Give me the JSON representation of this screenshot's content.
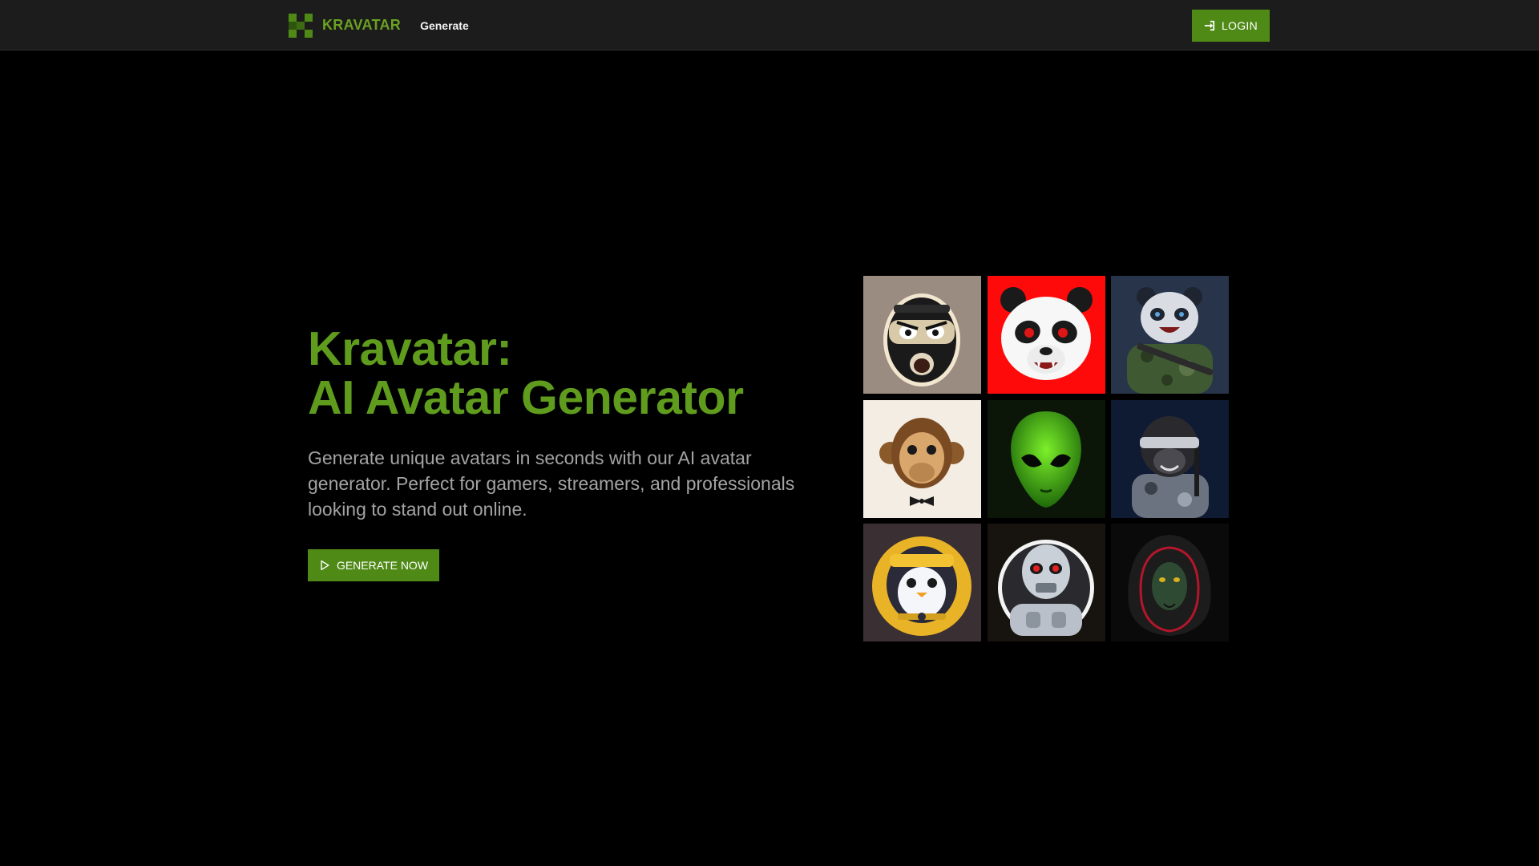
{
  "header": {
    "brand_name": "KRAVATAR",
    "nav_generate": "Generate",
    "login_label": "LOGIN",
    "icons": {
      "logo": "pixel-grid-logo-icon",
      "login": "sign-in-icon"
    }
  },
  "hero": {
    "title_line1": "Kravatar:",
    "title_line2": "AI Avatar Generator",
    "description": "Generate unique avatars in seconds with our AI avatar generator. Perfect for gamers, streamers, and professionals looking to stand out online.",
    "cta_label": "GENERATE NOW",
    "cta_icon": "play-icon"
  },
  "gallery": {
    "avatars": [
      {
        "subject": "masked-ninja",
        "bg": "#9b8c82"
      },
      {
        "subject": "angry-panda",
        "bg": "#ff0a0a"
      },
      {
        "subject": "soldier-panda",
        "bg": "#27344a"
      },
      {
        "subject": "monkey-bowtie",
        "bg": "#f3ede3"
      },
      {
        "subject": "green-alien",
        "bg": "#0b1508"
      },
      {
        "subject": "blindfold-gorilla",
        "bg": "#0f1a33"
      },
      {
        "subject": "ninja-penguin",
        "bg": "#3a2f33"
      },
      {
        "subject": "robot-skull",
        "bg": "#17130f"
      },
      {
        "subject": "hooded-cobra",
        "bg": "#0a0a0a"
      }
    ]
  },
  "colors": {
    "accent": "#5f9b1d",
    "button": "#4f8a17",
    "navbar_bg": "#1c1c1c",
    "page_bg": "#000000",
    "text_muted": "#a3a3a3"
  }
}
